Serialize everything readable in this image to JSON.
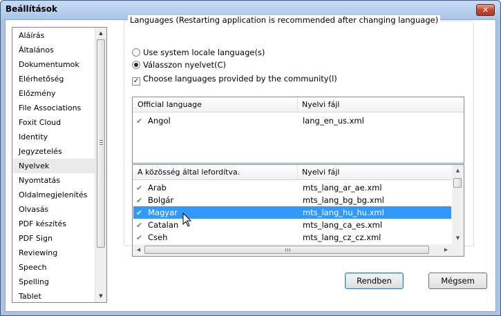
{
  "window": {
    "title": "Beállítások",
    "close_glyph": "✕"
  },
  "sidebar": {
    "items": [
      {
        "label": "Aláírás"
      },
      {
        "label": "Általános"
      },
      {
        "label": "Dokumentumok"
      },
      {
        "label": "Elérhetőség"
      },
      {
        "label": "Előzmény"
      },
      {
        "label": "File Associations"
      },
      {
        "label": "Foxit Cloud"
      },
      {
        "label": "Identity"
      },
      {
        "label": "Jegyzetelés"
      },
      {
        "label": "Nyelvek",
        "selected": true
      },
      {
        "label": "Nyomtatás"
      },
      {
        "label": "Oldalmegjelenítés"
      },
      {
        "label": "Olvasás"
      },
      {
        "label": "PDF készítés"
      },
      {
        "label": "PDF Sign"
      },
      {
        "label": "Reviewing"
      },
      {
        "label": "Speech"
      },
      {
        "label": "Spelling"
      },
      {
        "label": "Tablet"
      }
    ]
  },
  "languages": {
    "group_title": "Languages (Restarting application is recommended after changing language)",
    "option_system": "Use system locale language(s)",
    "option_choose": "Válasszon nyelvet(C)",
    "selected_option": "option_choose",
    "community_checkbox": "Choose languages provided by the community(l)",
    "community_checked": true,
    "official": {
      "headers": [
        "Official language",
        "Nyelvi fájl"
      ],
      "rows": [
        {
          "name": "Angol",
          "file": "lang_en_us.xml"
        }
      ]
    },
    "community": {
      "headers": [
        "A közösség által lefordítva.",
        "Nyelvi fájl"
      ],
      "rows": [
        {
          "name": "Arab",
          "file": "mts_lang_ar_ae.xml"
        },
        {
          "name": "Bolgár",
          "file": "mts_lang_bg_bg.xml"
        },
        {
          "name": "Magyar",
          "file": "mts_lang_hu_hu.xml",
          "selected": true
        },
        {
          "name": "Catalan",
          "file": "mts_lang_ca_es.xml"
        },
        {
          "name": "Cseh",
          "file": "mts_lang_cz_cz.xml"
        }
      ]
    }
  },
  "buttons": {
    "ok": "Rendben",
    "cancel": "Mégsem"
  },
  "icons": {
    "row_check": "checkmark-icon",
    "close": "close-icon",
    "cursor": "mouse-pointer-icon"
  },
  "colors": {
    "selection": "#3399ff",
    "titlebar": "#a8c5e8",
    "default_button_border": "#3c7fb1"
  }
}
